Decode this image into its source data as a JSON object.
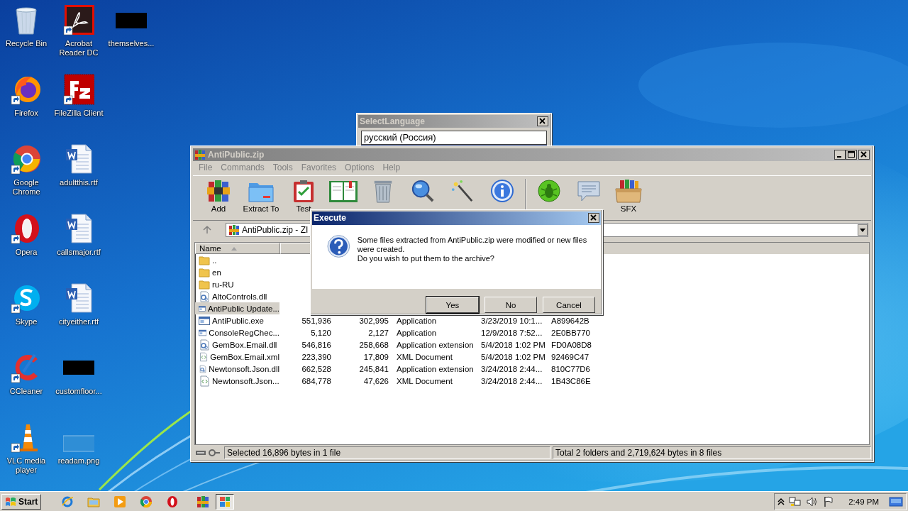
{
  "desktop": {
    "icons": [
      {
        "label": "Recycle Bin"
      },
      {
        "label": "Firefox"
      },
      {
        "label": "Google Chrome"
      },
      {
        "label": "Opera"
      },
      {
        "label": "Skype"
      },
      {
        "label": "CCleaner"
      },
      {
        "label": "VLC media player"
      },
      {
        "label": "Acrobat Reader DC"
      },
      {
        "label": "FileZilla Client"
      },
      {
        "label": "adultthis.rtf"
      },
      {
        "label": "callsmajor.rtf"
      },
      {
        "label": "cityeither.rtf"
      },
      {
        "label": "customfloor..."
      },
      {
        "label": "readam.png"
      },
      {
        "label": "themselves..."
      }
    ]
  },
  "language_window": {
    "title": "SelectLanguage",
    "value": "русский (Россия)"
  },
  "archive_window": {
    "title": "AntiPublic.zip",
    "menu": [
      "File",
      "Commands",
      "Tools",
      "Favorites",
      "Options",
      "Help"
    ],
    "toolbar": [
      {
        "kind": "tool",
        "label": "Add"
      },
      {
        "kind": "tool",
        "label": "Extract To"
      },
      {
        "kind": "tool",
        "label": "Test"
      },
      {
        "kind": "tool"
      },
      {
        "kind": "tool"
      },
      {
        "kind": "tool"
      },
      {
        "kind": "tool"
      },
      {
        "kind": "tool"
      },
      {
        "kind": "separator"
      },
      {
        "kind": "tool"
      },
      {
        "kind": "tool"
      },
      {
        "kind": "tool",
        "label": "SFX"
      }
    ],
    "address": "AntiPublic.zip - ZI",
    "columns": [
      "Name"
    ],
    "files": [
      {
        "kind": "folder",
        "name": "..",
        "selected": false
      },
      {
        "kind": "folder",
        "name": "en",
        "selected": false
      },
      {
        "kind": "folder",
        "name": "ru-RU",
        "selected": false
      },
      {
        "kind": "dll",
        "name": "AltoControls.dll",
        "selected": false
      },
      {
        "kind": "exe",
        "name": "AntiPublic Update...",
        "selected": true
      },
      {
        "kind": "exe",
        "name": "AntiPublic.exe",
        "size": "551,936",
        "packed": "302,995",
        "type": "Application",
        "modified": "3/23/2019 10:1...",
        "crc": "A899642B",
        "selected": false
      },
      {
        "kind": "exe",
        "name": "ConsoleRegChec...",
        "size": "5,120",
        "packed": "2,127",
        "type": "Application",
        "modified": "12/9/2018 7:52...",
        "crc": "2E0BB770",
        "selected": false
      },
      {
        "kind": "dll",
        "name": "GemBox.Email.dll",
        "size": "546,816",
        "packed": "258,668",
        "type": "Application extension",
        "modified": "5/4/2018 1:02 PM",
        "crc": "FD0A08D8",
        "selected": false
      },
      {
        "kind": "xml",
        "name": "GemBox.Email.xml",
        "size": "223,390",
        "packed": "17,809",
        "type": "XML Document",
        "modified": "5/4/2018 1:02 PM",
        "crc": "92469C47",
        "selected": false
      },
      {
        "kind": "dll",
        "name": "Newtonsoft.Json.dll",
        "size": "662,528",
        "packed": "245,841",
        "type": "Application extension",
        "modified": "3/24/2018 2:44...",
        "crc": "810C77D6",
        "selected": false
      },
      {
        "kind": "xml",
        "name": "Newtonsoft.Json...",
        "size": "684,778",
        "packed": "47,626",
        "type": "XML Document",
        "modified": "3/24/2018 2:44...",
        "crc": "1B43C86E",
        "selected": false
      }
    ],
    "status_left": "Selected 16,896 bytes in 1 file",
    "status_right": "Total 2 folders and 2,719,624 bytes in 8 files"
  },
  "dialog": {
    "title": "Execute",
    "message": "Some files extracted from AntiPublic.zip were modified or new files were created.\nDo you wish to put them to the archive?",
    "buttons": [
      {
        "label": "Yes",
        "default": true
      },
      {
        "label": "No",
        "default": false
      },
      {
        "label": "Cancel",
        "default": false
      }
    ]
  },
  "taskbar": {
    "start": "Start",
    "apps": [
      {
        "selected": false
      },
      {
        "selected": false
      },
      {
        "selected": false
      },
      {
        "selected": false
      },
      {
        "selected": false
      },
      {
        "selected": false
      },
      {
        "selected": true
      }
    ],
    "clock": "2:49 PM"
  }
}
